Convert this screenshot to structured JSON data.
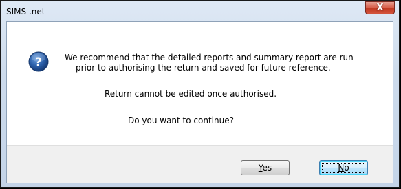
{
  "window": {
    "title": "SIMS .net",
    "close_label": "X"
  },
  "icon": "question-mark-icon",
  "message": {
    "line1": "We recommend that the detailed reports and summary report are run",
    "line2": "prior to authorising the return and saved for future reference.",
    "line3": "Return cannot be edited once authorised.",
    "line4": "Do you want to continue?"
  },
  "buttons": {
    "yes": {
      "accel": "Y",
      "rest": "es"
    },
    "no": {
      "accel": "N",
      "rest": "o"
    }
  },
  "colors": {
    "icon_blue": "#2a5ea8",
    "close_red": "#c13a22",
    "default_button_border": "#3c7fb1"
  }
}
